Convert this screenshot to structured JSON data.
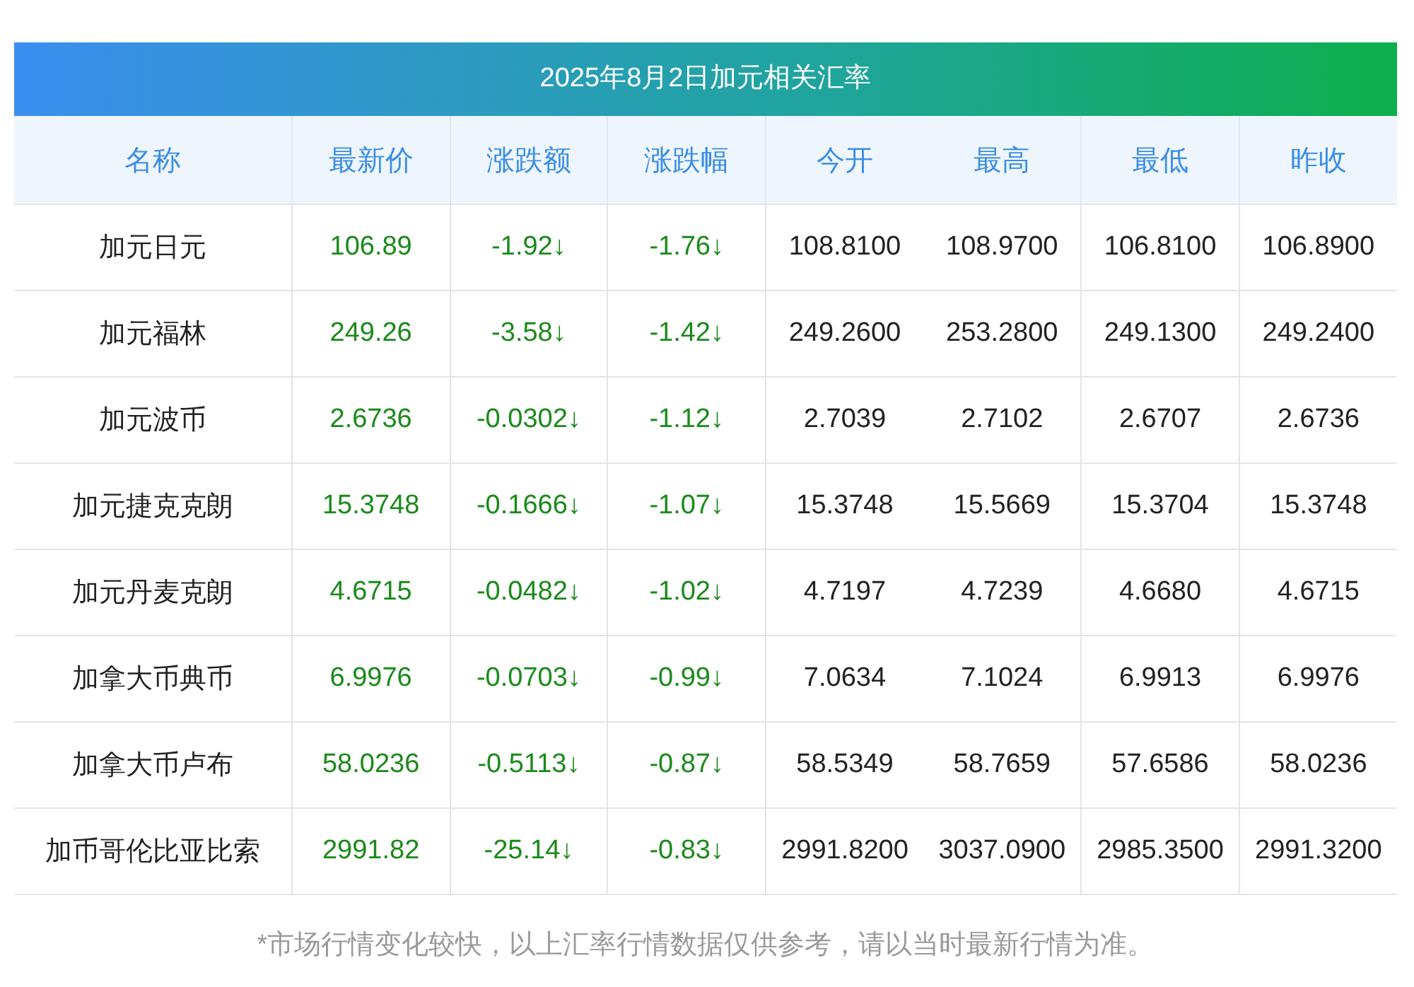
{
  "title": "2025年8月2日加元相关汇率",
  "columns": [
    "名称",
    "最新价",
    "涨跌额",
    "涨跌幅",
    "今开",
    "最高",
    "最低",
    "昨收"
  ],
  "rows": [
    {
      "color": "#1a8a1a",
      "cells": [
        "加元日元",
        "106.89",
        "-1.92↓",
        "-1.76↓",
        "108.8100",
        "108.9700",
        "106.8100",
        "106.8900"
      ]
    },
    {
      "color": "#1a8a1a",
      "cells": [
        "加元福林",
        "249.26",
        "-3.58↓",
        "-1.42↓",
        "249.2600",
        "253.2800",
        "249.1300",
        "249.2400"
      ]
    },
    {
      "color": "#1a8a1a",
      "cells": [
        "加元波币",
        "2.6736",
        "-0.0302↓",
        "-1.12↓",
        "2.7039",
        "2.7102",
        "2.6707",
        "2.6736"
      ]
    },
    {
      "color": "#1a8a1a",
      "cells": [
        "加元捷克克朗",
        "15.3748",
        "-0.1666↓",
        "-1.07↓",
        "15.3748",
        "15.5669",
        "15.3704",
        "15.3748"
      ]
    },
    {
      "color": "#1a8a1a",
      "cells": [
        "加元丹麦克朗",
        "4.6715",
        "-0.0482↓",
        "-1.02↓",
        "4.7197",
        "4.7239",
        "4.6680",
        "4.6715"
      ]
    },
    {
      "color": "#1a8a1a",
      "cells": [
        "加拿大币典币",
        "6.9976",
        "-0.0703↓",
        "-0.99↓",
        "7.0634",
        "7.1024",
        "6.9913",
        "6.9976"
      ]
    },
    {
      "color": "#1a8a1a",
      "cells": [
        "加拿大币卢布",
        "58.0236",
        "-0.5113↓",
        "-0.87↓",
        "58.5349",
        "58.7659",
        "57.6586",
        "58.0236"
      ]
    },
    {
      "color": "#1a8a1a",
      "cells": [
        "加币哥伦比亚比索",
        "2991.82",
        "-25.14↓",
        "-0.83↓",
        "2991.8200",
        "3037.0900",
        "2985.3500",
        "2991.3200"
      ]
    }
  ],
  "footnote": "*市场行情变化较快，以上汇率行情数据仅供参考，请以当时最新行情为准。"
}
